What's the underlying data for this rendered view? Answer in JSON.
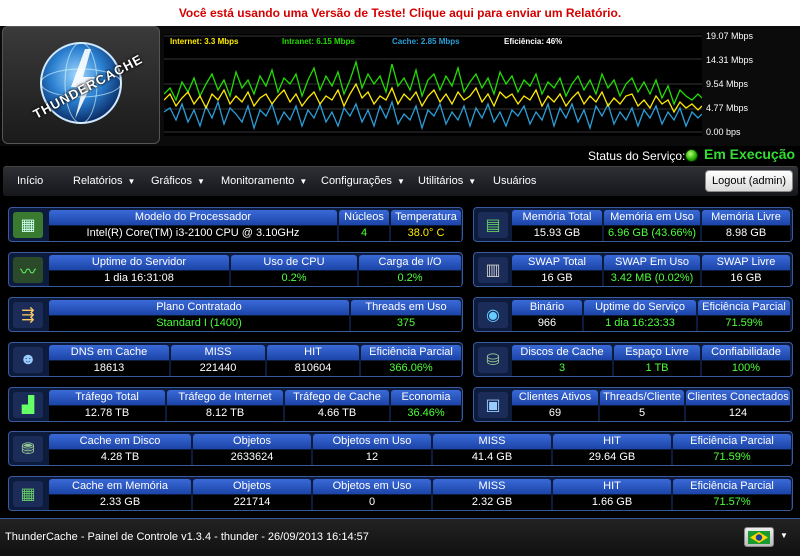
{
  "banner": {
    "text": "Você está usando uma Versão de Teste! Clique aqui para enviar um Relatório."
  },
  "logo": {
    "text": "THUNDERCACHE"
  },
  "graph": {
    "legend": {
      "internet": "Internet: 3.3 Mbps",
      "intranet": "Intranet: 6.15 Mbps",
      "cache": "Cache: 2.85 Mbps",
      "efficiency": "Eficiência: 46%"
    },
    "colors": {
      "internet": "#ffea00",
      "intranet": "#22dd00",
      "cache": "#2a9ed8"
    },
    "y_labels": [
      "19.07 Mbps",
      "14.31 Mbps",
      "9.54 Mbps",
      "4.77 Mbps",
      "0.00 bps"
    ]
  },
  "service": {
    "label": "Status do Serviço:",
    "status": "Em Execução"
  },
  "nav": {
    "items": [
      {
        "label": "Início"
      },
      {
        "label": "Relatórios",
        "dropdown": true
      },
      {
        "label": "Gráficos",
        "dropdown": true
      },
      {
        "label": "Monitoramento",
        "dropdown": true
      },
      {
        "label": "Configurações",
        "dropdown": true
      },
      {
        "label": "Utilitários",
        "dropdown": true
      },
      {
        "label": "Usuários"
      }
    ],
    "logout": "Logout (admin)"
  },
  "panels": {
    "processor": {
      "model_h": "Modelo do Processador",
      "model_v": "Intel(R) Core(TM) i3-2100 CPU @ 3.10GHz",
      "cores_h": "Núcleos",
      "cores_v": "4",
      "temp_h": "Temperatura",
      "temp_v": "38.0° C"
    },
    "memory": {
      "total_h": "Memória Total",
      "total_v": "15.93 GB",
      "used_h": "Memória em Uso",
      "used_v": "6.96 GB (43.66%)",
      "free_h": "Memória Livre",
      "free_v": "8.98 GB"
    },
    "uptime": {
      "uptime_h": "Uptime do Servidor",
      "uptime_v": "1 dia 16:31:08",
      "cpu_h": "Uso de CPU",
      "cpu_v": "0.2%",
      "io_h": "Carga de I/O",
      "io_v": "0.2%"
    },
    "swap": {
      "total_h": "SWAP Total",
      "total_v": "16 GB",
      "used_h": "SWAP Em Uso",
      "used_v": "3.42 MB (0.02%)",
      "free_h": "SWAP Livre",
      "free_v": "16 GB"
    },
    "plan": {
      "plan_h": "Plano Contratado",
      "plan_v": "Standard I (1400)",
      "threads_h": "Threads em Uso",
      "threads_v": "375"
    },
    "binary": {
      "bin_h": "Binário",
      "bin_v": "966",
      "svc_uptime_h": "Uptime do Serviço",
      "svc_uptime_v": "1 dia 16:23:33",
      "eff_h": "Eficiência Parcial",
      "eff_v": "71.59%"
    },
    "dns": {
      "dns_h": "DNS em Cache",
      "dns_v": "18613",
      "miss_h": "MISS",
      "miss_v": "221440",
      "hit_h": "HIT",
      "hit_v": "810604",
      "eff_h": "Eficiência Parcial",
      "eff_v": "366.06%"
    },
    "disks": {
      "disks_h": "Discos de Cache",
      "disks_v": "3",
      "space_h": "Espaço Livre",
      "space_v": "1 TB",
      "rel_h": "Confiabilidade",
      "rel_v": "100%"
    },
    "traffic": {
      "total_h": "Tráfego Total",
      "total_v": "12.78 TB",
      "internet_h": "Tráfego de Internet",
      "internet_v": "8.12 TB",
      "cache_h": "Tráfego de Cache",
      "cache_v": "4.66 TB",
      "eco_h": "Economia",
      "eco_v": "36.46%"
    },
    "clients": {
      "active_h": "Clientes Ativos",
      "active_v": "69",
      "tpc_h": "Threads/Cliente",
      "tpc_v": "5",
      "conn_h": "Clientes Conectados",
      "conn_v": "124"
    },
    "disk_cache": {
      "cache_h": "Cache em Disco",
      "cache_v": "4.28 TB",
      "obj_h": "Objetos",
      "obj_v": "2633624",
      "inuse_h": "Objetos em Uso",
      "inuse_v": "12",
      "miss_h": "MISS",
      "miss_v": "41.4 GB",
      "hit_h": "HIT",
      "hit_v": "29.64 GB",
      "eff_h": "Eficiência Parcial",
      "eff_v": "71.59%"
    },
    "mem_cache": {
      "cache_h": "Cache em Memória",
      "cache_v": "2.33 GB",
      "obj_h": "Objetos",
      "obj_v": "221714",
      "inuse_h": "Objetos em Uso",
      "inuse_v": "0",
      "miss_h": "MISS",
      "miss_v": "2.32 GB",
      "hit_h": "HIT",
      "hit_v": "1.66 GB",
      "eff_h": "Eficiência Parcial",
      "eff_v": "71.57%"
    }
  },
  "footer": {
    "text": "ThunderCache - Painel de Controle v1.3.4 - thunder - 26/09/2013 16:14:57"
  }
}
